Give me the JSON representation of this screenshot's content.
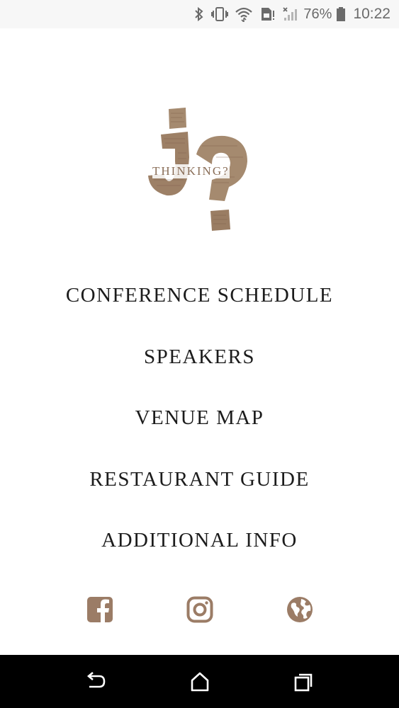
{
  "status_bar": {
    "icons": [
      "bluetooth-icon",
      "vibrate-icon",
      "wifi-icon",
      "sim-card-alert-icon",
      "signal-no-service-icon",
      "battery-icon"
    ],
    "battery_percent": "76%",
    "time": "10:22"
  },
  "logo": {
    "text": "THINKING?",
    "colors": {
      "parchment": "#a58a6f",
      "parchment_dark": "#8a6e58"
    }
  },
  "menu": {
    "items": [
      {
        "label": "CONFERENCE SCHEDULE"
      },
      {
        "label": "SPEAKERS"
      },
      {
        "label": "VENUE MAP"
      },
      {
        "label": "RESTAURANT GUIDE"
      },
      {
        "label": "ADDITIONAL INFO"
      }
    ]
  },
  "social": {
    "icons": [
      "facebook-icon",
      "instagram-icon",
      "globe-icon"
    ],
    "color": "#9b7c66"
  },
  "navigation_bar": {
    "buttons": [
      "back-icon",
      "home-icon",
      "recents-icon"
    ]
  }
}
